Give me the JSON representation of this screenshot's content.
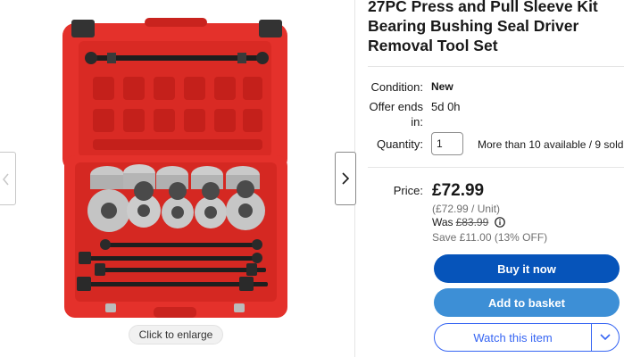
{
  "gallery": {
    "enlarge_label": "Click to enlarge"
  },
  "listing": {
    "title": "27PC Press and Pull Sleeve Kit Bearing Bushing Seal Driver Removal Tool Set",
    "condition_label": "Condition:",
    "condition_value": "New",
    "offer_label_line1": "Offer ends",
    "offer_label_line2": "in:",
    "offer_value": "5d 0h",
    "quantity_label": "Quantity:",
    "quantity_value": "1",
    "availability": "More than 10 available / 9 sold",
    "price_label": "Price:",
    "price": "£72.99",
    "unit_price": "(£72.99 / Unit)",
    "was_label": "Was",
    "was_price": "£83.99",
    "save_text": "Save £11.00 (13% OFF)"
  },
  "buttons": {
    "buy_now": "Buy it now",
    "add_to_basket": "Add to basket",
    "watch": "Watch this item"
  },
  "colors": {
    "buy_now": "#0654ba",
    "add_to_basket": "#3d8fd6",
    "watch_border": "#3665f3",
    "case_red": "#e4312b"
  },
  "icons": [
    "chevron-left-icon",
    "chevron-right-icon",
    "info-icon",
    "chevron-down-icon"
  ]
}
